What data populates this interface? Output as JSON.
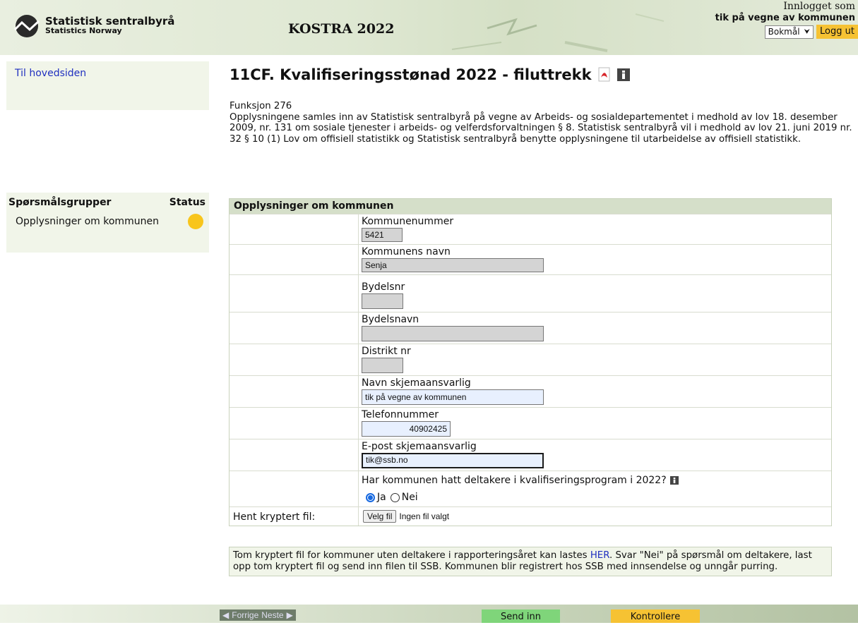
{
  "header": {
    "logo_line1": "Statistisk sentralbyrå",
    "logo_line2": "Statistics Norway",
    "app_title": "KOSTRA 2022",
    "logged_in_label": "Innlogget som",
    "user_name": "tik på vegne av kommunen",
    "language": "Bokmål",
    "logout_label": "Logg ut"
  },
  "nav": {
    "home_link": "Til hovedsiden"
  },
  "question_groups": {
    "header": "Spørsmålsgrupper",
    "status_header": "Status",
    "items": [
      {
        "label": "Opplysninger om kommunen",
        "status_color": "#f8c51c"
      }
    ]
  },
  "page": {
    "title": "11CF. Kvalifiseringsstønad 2022 - filuttrekk",
    "function_line": "Funksjon 276",
    "intro": "Opplysningene samles inn av Statistisk sentralbyrå på vegne av Arbeids- og sosialdepartementet i medhold av lov 18. desember 2009, nr. 131 om sosiale tjenester i arbeids- og velferdsforvaltningen § 8. Statistisk sentralbyrå vil i medhold av lov 21. juni 2019 nr. 32 § 10 (1) Lov om offisiell statistikk og Statistisk sentralbyrå benytte opplysningene til utarbeidelse av offisiell statistikk."
  },
  "form": {
    "section_title": "Opplysninger om kommunen",
    "fields": {
      "kommunenummer": {
        "label": "Kommunenummer",
        "value": "5421"
      },
      "kommunens_navn": {
        "label": "Kommunens navn",
        "value": "Senja"
      },
      "bydelsnr": {
        "label": "Bydelsnr",
        "value": ""
      },
      "bydelsnavn": {
        "label": "Bydelsnavn",
        "value": ""
      },
      "distrikt_nr": {
        "label": "Distrikt nr",
        "value": ""
      },
      "navn_ansvarlig": {
        "label": "Navn skjemaansvarlig",
        "value": "tik på vegne av kommunen"
      },
      "telefonnummer": {
        "label": "Telefonnummer",
        "value": "40902425"
      },
      "epost": {
        "label": "E-post skjemaansvarlig",
        "value": "tik@ssb.no"
      }
    },
    "question": {
      "label": "Har kommunen hatt deltakere i kvalifiseringsprogram i 2022?",
      "options": [
        "Ja",
        "Nei"
      ],
      "selected": "Ja"
    },
    "file_row": {
      "label": "Hent kryptert fil:",
      "button_label": "Velg fil",
      "file_status": "Ingen fil valgt"
    }
  },
  "note": {
    "before_link": "Tom kryptert fil for kommuner uten deltakere i rapporteringsåret kan lastes ",
    "link_text": "HER",
    "after_link": ". Svar \"Nei\" på spørsmål om deltakere, last opp tom kryptert fil og send inn filen til SSB. Kommunen blir registrert hos SSB med innsendelse og unngår purring."
  },
  "footer": {
    "prev_label": "Forrige",
    "next_label": "Neste",
    "send_label": "Send inn",
    "check_label": "Kontrollere"
  }
}
